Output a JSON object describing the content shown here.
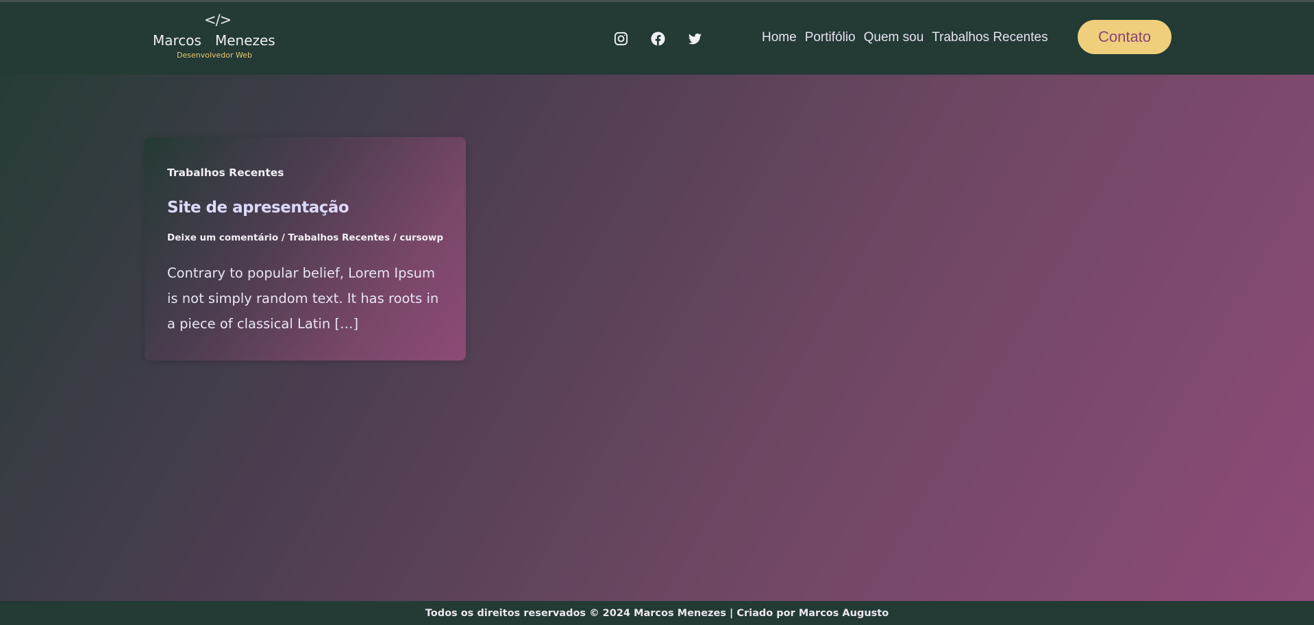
{
  "header": {
    "logo": {
      "code": "</>",
      "first_name": "Marcos",
      "last_name": "Menezes",
      "subtitle": "Desenvolvedor Web"
    },
    "social": [
      {
        "icon": "instagram-icon"
      },
      {
        "icon": "facebook-icon"
      },
      {
        "icon": "twitter-icon"
      }
    ],
    "nav": [
      {
        "label": "Home"
      },
      {
        "label": "Portifólio"
      },
      {
        "label": "Quem sou"
      },
      {
        "label": "Trabalhos Recentes"
      }
    ],
    "cta_label": "Contato"
  },
  "post": {
    "category": "Trabalhos Recentes",
    "title": "Site de apresentação",
    "meta": {
      "comments": "Deixe um comentário",
      "separator": " / ",
      "category": "Trabalhos Recentes",
      "author": "cursowp"
    },
    "excerpt": "Contrary to popular belief, Lorem Ipsum is not simply random text. It has roots in a piece of classical Latin […]"
  },
  "footer": {
    "text": "Todos os direitos reservados © 2024 Marcos Menezes | Criado por Marcos Augusto"
  },
  "colors": {
    "header_bg": "#233a35",
    "accent_yellow": "#efcf7c",
    "accent_purple": "#8a4575"
  }
}
